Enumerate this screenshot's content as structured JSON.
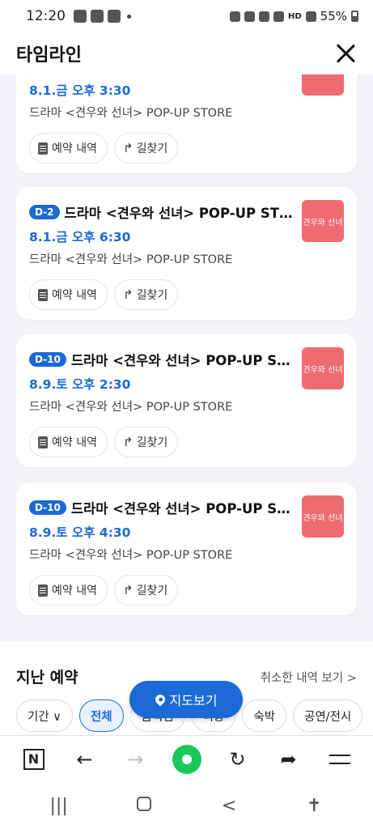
{
  "status": {
    "time": "12:20",
    "battery": "55%",
    "network": "HD"
  },
  "header": {
    "title": "타임라인"
  },
  "cards": [
    {
      "badge": "",
      "title": "",
      "date": "8.1.금 오후 3:30",
      "venue": "드라마 <견우와 선녀> POP-UP STORE",
      "thumb": "",
      "history": "예약 내역",
      "directions": "길찾기"
    },
    {
      "badge": "D-2",
      "title": "드라마 <견우와 선녀> POP-UP STORE",
      "date": "8.1.금 오후 6:30",
      "venue": "드라마 <견우와 선녀> POP-UP STORE",
      "thumb": "견우와 선녀",
      "history": "예약 내역",
      "directions": "길찾기"
    },
    {
      "badge": "D-10",
      "title": "드라마 <견우와 선녀> POP-UP STO...",
      "date": "8.9.토 오후 2:30",
      "venue": "드라마 <견우와 선녀> POP-UP STORE",
      "thumb": "견우와 선녀",
      "history": "예약 내역",
      "directions": "길찾기"
    },
    {
      "badge": "D-10",
      "title": "드라마 <견우와 선녀> POP-UP STO...",
      "date": "8.9.토 오후 4:30",
      "venue": "드라마 <견우와 선녀> POP-UP STORE",
      "thumb": "견우와 선녀",
      "history": "예약 내역",
      "directions": "길찾기"
    }
  ],
  "past": {
    "title": "지난 예약",
    "cancel_link": "취소한 내역 보기 >",
    "filters": [
      "기간 ∨",
      "전체",
      "음식점",
      "미용",
      "숙박",
      "공연/전시"
    ]
  },
  "map_button": "지도보기",
  "colors": {
    "accent": "#1b6ad6",
    "thumb": "#ee6b6f",
    "naver_green": "#19c75a"
  }
}
